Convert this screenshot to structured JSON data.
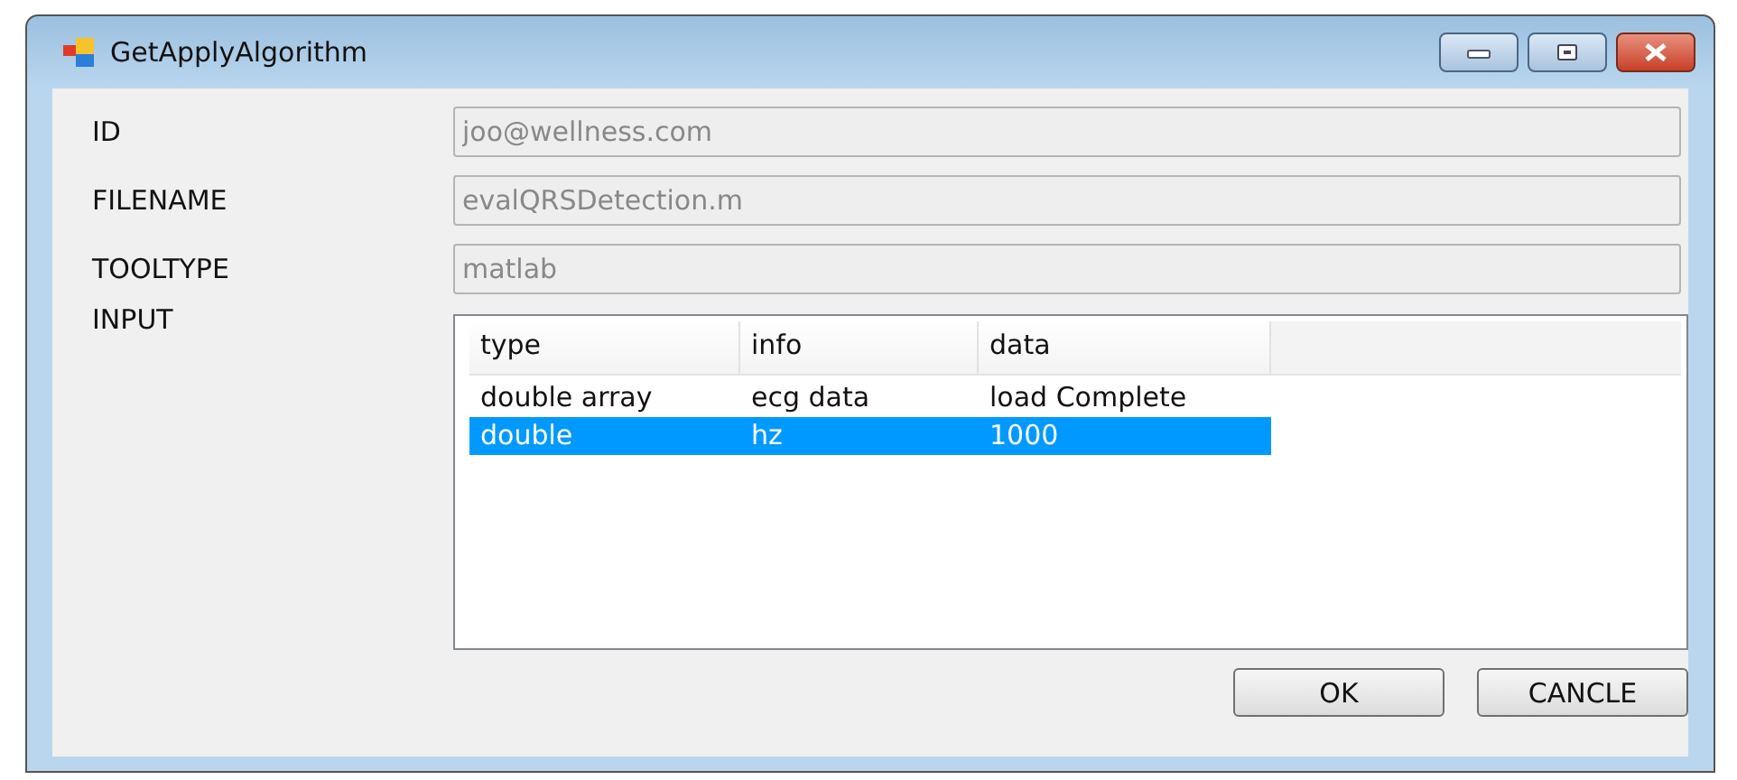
{
  "window": {
    "title": "GetApplyAlgorithm"
  },
  "fields": [
    {
      "label": "ID",
      "value": "joo@wellness.com"
    },
    {
      "label": "FILENAME",
      "value": "evalQRSDetection.m"
    },
    {
      "label": "TOOLTYPE",
      "value": "matlab"
    }
  ],
  "input": {
    "label": "INPUT",
    "columns": [
      "type",
      "info",
      "data"
    ],
    "rows": [
      {
        "cells": [
          "double array",
          "ecg data",
          "load Complete"
        ],
        "selected": false
      },
      {
        "cells": [
          "double",
          "hz",
          "1000"
        ],
        "selected": true
      }
    ]
  },
  "buttons": [
    "OK",
    "CANCLE"
  ]
}
